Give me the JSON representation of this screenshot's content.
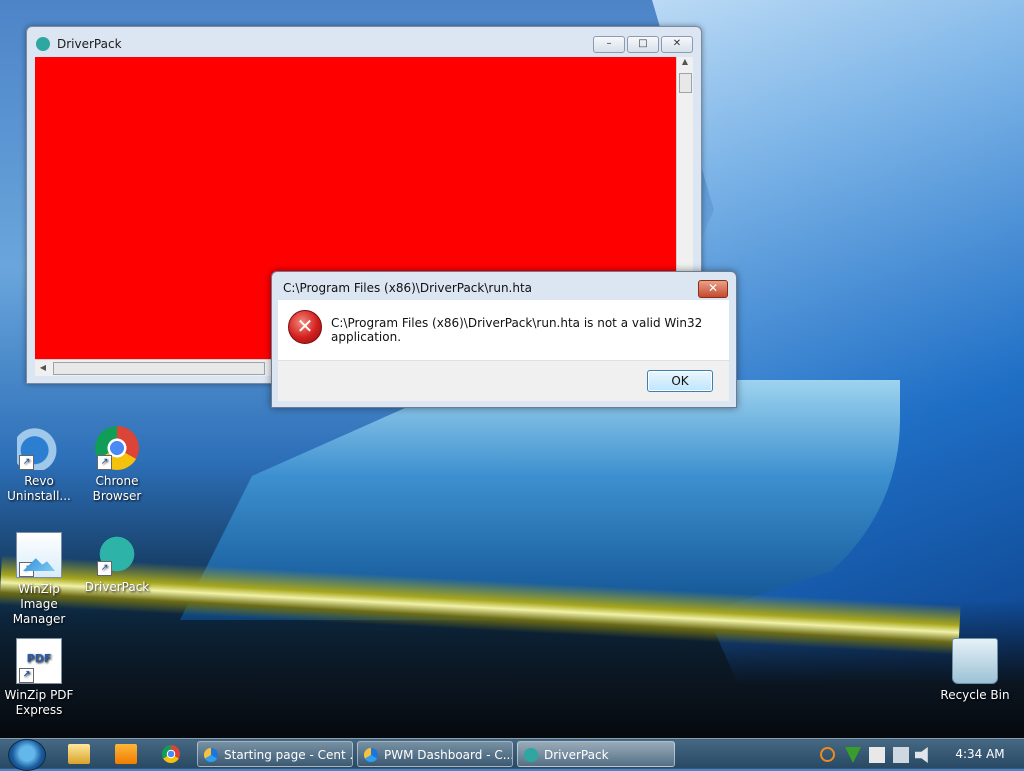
{
  "desktop": {
    "icons": [
      {
        "label": "Revo Uninstall...",
        "icon": "revo-uninstaller-icon"
      },
      {
        "label": "Chrone Browser",
        "icon": "chrome-icon"
      },
      {
        "label": "WinZip Image Manager",
        "icon": "winzip-image-icon"
      },
      {
        "label": "DriverPack",
        "icon": "driverpack-icon"
      },
      {
        "label": "WinZip PDF Express",
        "icon": "winzip-pdf-icon"
      },
      {
        "label": "Recycle Bin",
        "icon": "recycle-bin-icon"
      }
    ],
    "pdf_icon_text": "PDF"
  },
  "driverpack_window": {
    "title": "DriverPack",
    "controls": {
      "minimize": "–",
      "maximize": "□",
      "close": "✕"
    },
    "content_color": "#ff0000"
  },
  "error_dialog": {
    "title": "C:\\Program Files (x86)\\DriverPack\\run.hta",
    "close_glyph": "✕",
    "icon_glyph": "✕",
    "message": "C:\\Program Files (x86)\\DriverPack\\run.hta is not a valid Win32 application.",
    "ok_label": "OK"
  },
  "taskbar": {
    "tasks": [
      {
        "label": "Starting page - Cent ...",
        "icon": "chromium-icon"
      },
      {
        "label": "PWM Dashboard - C...",
        "icon": "chromium-icon"
      },
      {
        "label": "DriverPack",
        "icon": "driverpack-icon"
      }
    ],
    "clock": "4:34 AM"
  }
}
